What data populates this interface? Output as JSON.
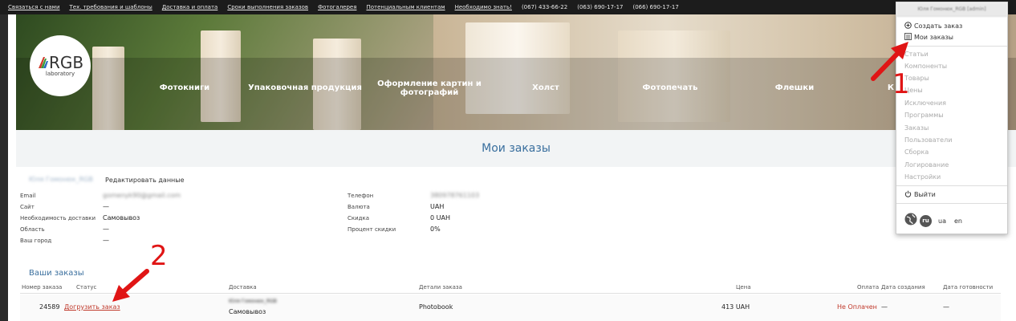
{
  "topbar": {
    "links": [
      "Связаться с нами",
      "Тех. требования и шаблоны",
      "Доставка и оплата",
      "Сроки выполнения заказов",
      "Фотогалерея",
      "Потенциальным клиентам",
      "Необходимо знать!"
    ],
    "phones": [
      "(067) 433-66-22",
      "(063) 690-17-17",
      "(066) 690-17-17"
    ]
  },
  "logo": {
    "brand": "RGB",
    "sub": "laboratory"
  },
  "nav": [
    "Фотокниги",
    "Упаковочная продукция",
    "Оформление картин и фотографий",
    "Холст",
    "Фотопечать",
    "Флешки",
    "К"
  ],
  "page_title": "Мои заказы",
  "profile": {
    "name": "Юля Гомонюк_RGB",
    "edit_label": "Редактировать данные",
    "left": [
      {
        "label": "Email",
        "value": "gomenyk90@gmail.com",
        "blurred": true
      },
      {
        "label": "Сайт",
        "value": "—"
      },
      {
        "label": "Необходимость доставки",
        "value": "Самовывоз"
      },
      {
        "label": "Область",
        "value": "—"
      },
      {
        "label": "Ваш город",
        "value": "—"
      }
    ],
    "right": [
      {
        "label": "Телефон",
        "value": "380978761103",
        "blurred": true
      },
      {
        "label": "Валюта",
        "value": "UAH"
      },
      {
        "label": "Скидка",
        "value": "0 UAH"
      },
      {
        "label": "Процент скидки",
        "value": "0%"
      }
    ]
  },
  "orders": {
    "title": "Ваши заказы",
    "columns": [
      "Номер заказа",
      "Статус",
      "Доставка",
      "Детали заказа",
      "Цена",
      "Оплата",
      "Дата создания",
      "Дата готовности"
    ],
    "rows": [
      {
        "number": "24589",
        "status": "Догрузить заказ",
        "delivery_name": "Юля Гомонюк_RGB",
        "delivery_method": "Самовывоз",
        "details": "Photobook",
        "price": "413 UAH",
        "payment": "Не Оплачен",
        "created": "—",
        "ready": "—"
      }
    ]
  },
  "dropdown": {
    "user": "Юля Гомонюк_RGB [admin]",
    "create_order": "Создать заказ",
    "my_orders": "Мои заказы",
    "admin_items": [
      "Статьи",
      "Компоненты",
      "Товары",
      "Цены",
      "Исключения",
      "Программы",
      "Заказы",
      "Пользователи",
      "Сборка",
      "Логирование",
      "Настройки"
    ],
    "logout": "Выйти",
    "langs": [
      "ru",
      "ua",
      "en"
    ]
  },
  "annotations": {
    "one": "1",
    "two": "2"
  },
  "colors": {
    "accent_blue": "#3a6f9e",
    "link_red": "#c0392b",
    "annotation_red": "#e01515"
  }
}
